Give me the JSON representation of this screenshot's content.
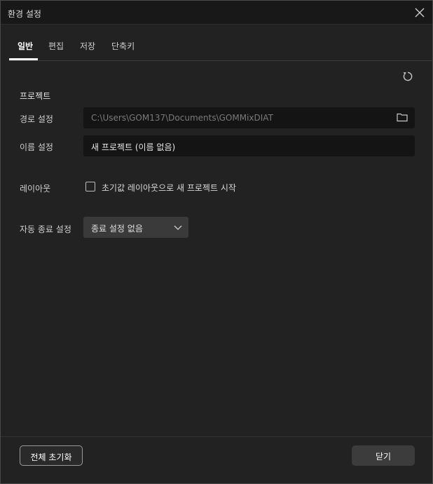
{
  "window": {
    "title": "환경 설정",
    "close_icon": "close-icon"
  },
  "tabs": [
    {
      "label": "일반",
      "active": true
    },
    {
      "label": "편집",
      "active": false
    },
    {
      "label": "저장",
      "active": false
    },
    {
      "label": "단축키",
      "active": false
    }
  ],
  "reset_icon": "reset-icon",
  "section": {
    "title": "프로젝트"
  },
  "path_setting": {
    "label": "경로 설정",
    "value": "C:\\Users\\GOM137\\Documents\\GOMMixDIAT",
    "icon": "folder-icon"
  },
  "name_setting": {
    "label": "이름 설정",
    "value": "새 프로젝트 (이름 없음)"
  },
  "layout_setting": {
    "label": "레이아웃",
    "checkbox_label": "초기값 레이아웃으로 새 프로젝트 시작",
    "checked": false
  },
  "autoclose_setting": {
    "label": "자동 종료 설정",
    "selected": "종료 설정 없음",
    "icon": "chevron-down-icon"
  },
  "footer": {
    "reset_all_label": "전체 초기화",
    "close_label": "닫기"
  },
  "colors": {
    "background": "#222222",
    "titlebar": "#181818",
    "input_bg": "#141414",
    "select_bg": "#3a3a3a",
    "text": "#d8d8d8"
  }
}
